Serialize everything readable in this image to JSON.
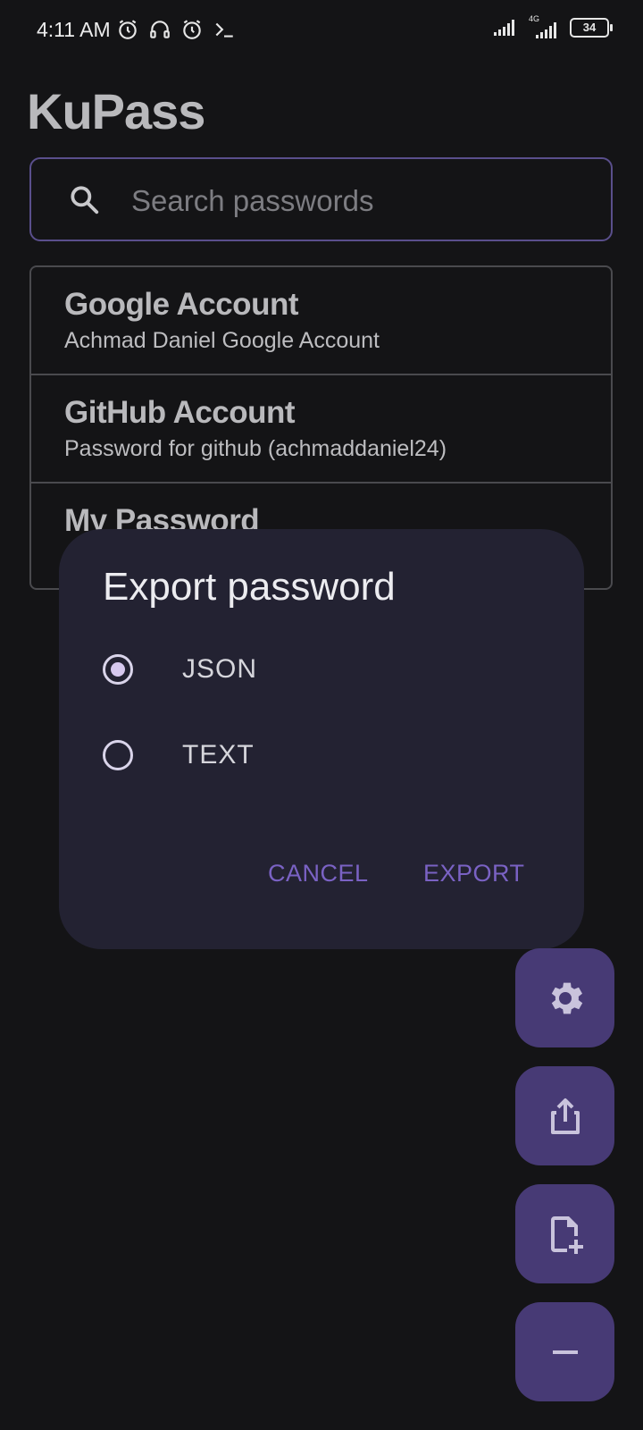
{
  "status_bar": {
    "time": "4:11 AM",
    "network": "4G",
    "battery": "34",
    "icons": [
      "alarm-icon",
      "headset-icon",
      "alarm-icon",
      "terminal-icon",
      "signal-icon",
      "signal-icon",
      "battery-icon"
    ]
  },
  "app": {
    "title": "KuPass"
  },
  "search": {
    "placeholder": "Search passwords",
    "value": ""
  },
  "passwords": [
    {
      "title": "Google Account",
      "description": "Achmad Daniel Google Account"
    },
    {
      "title": "GitHub Account",
      "description": "Password for github (achmaddaniel24)"
    },
    {
      "title": "My Password",
      "description": ""
    }
  ],
  "dialog": {
    "title": "Export password",
    "options": [
      {
        "label": "JSON",
        "selected": true
      },
      {
        "label": "TEXT",
        "selected": false
      }
    ],
    "cancel_label": "CANCEL",
    "export_label": "EXPORT"
  },
  "fabs": [
    {
      "icon": "gear-icon"
    },
    {
      "icon": "share-icon"
    },
    {
      "icon": "add-file-icon"
    },
    {
      "icon": "minus-icon"
    }
  ],
  "colors": {
    "background": "#141416",
    "dialog": "#232232",
    "accent": "#7a62c4",
    "fab": "#473a75"
  }
}
